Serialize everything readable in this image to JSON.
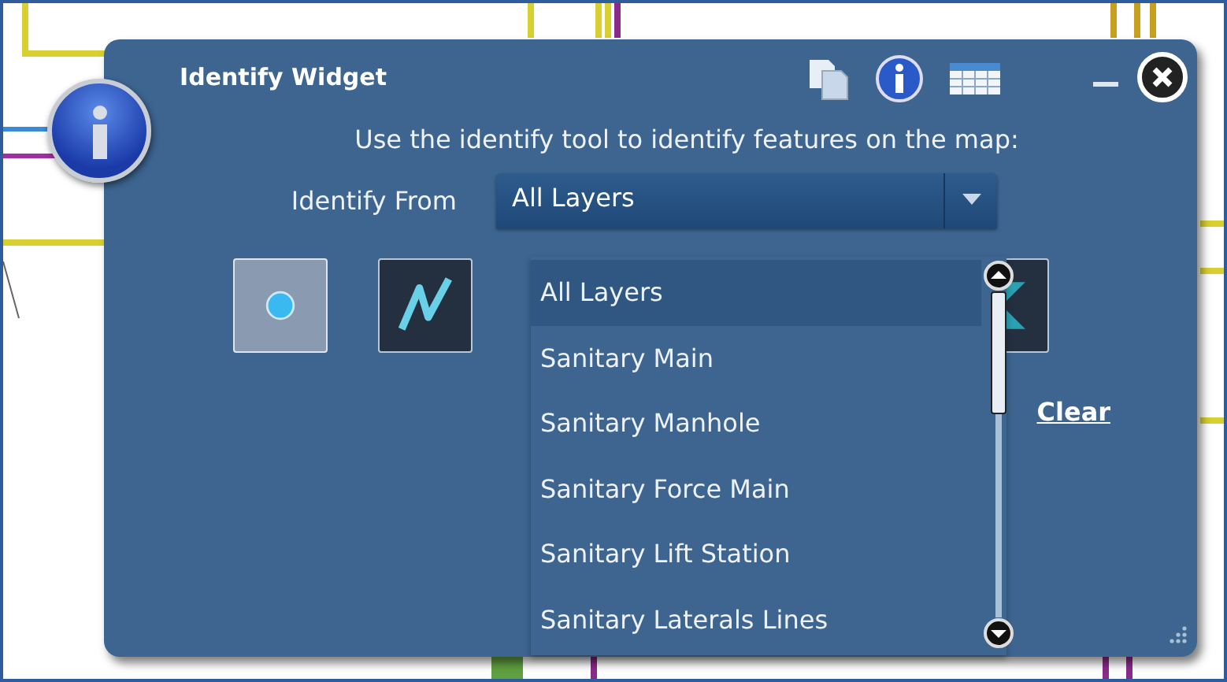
{
  "window": {
    "title": "Identify Widget"
  },
  "instruction": "Use the identify tool to identify features on the map:",
  "identify_from": {
    "label": "Identify From",
    "value": "All Layers",
    "expanded": true
  },
  "layer_options": [
    {
      "label": "All Layers",
      "selected": true
    },
    {
      "label": "Sanitary Main",
      "selected": false
    },
    {
      "label": "Sanitary Manhole",
      "selected": false
    },
    {
      "label": "Sanitary Force Main",
      "selected": false
    },
    {
      "label": "Sanitary Lift Station",
      "selected": false
    },
    {
      "label": "Sanitary Laterals Lines",
      "selected": false
    }
  ],
  "tools": [
    {
      "kind": "point",
      "selected": true
    },
    {
      "kind": "line",
      "selected": false
    },
    {
      "kind": "extent",
      "selected": false
    }
  ],
  "clear_link": "Clear"
}
